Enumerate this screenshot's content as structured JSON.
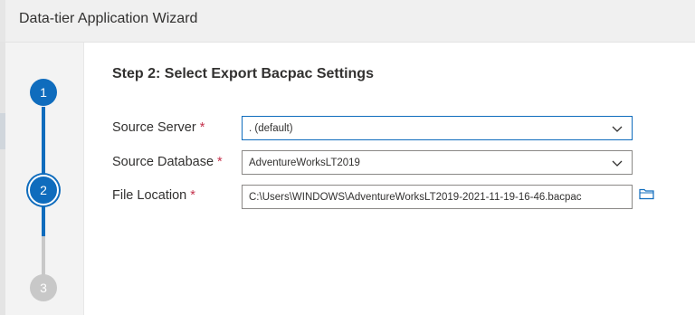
{
  "window": {
    "title": "Data-tier Application Wizard"
  },
  "steps": [
    {
      "number": "1",
      "state": "completed"
    },
    {
      "number": "2",
      "state": "current"
    },
    {
      "number": "3",
      "state": "pending"
    }
  ],
  "page": {
    "step_title": "Step 2: Select Export Bacpac Settings"
  },
  "form": {
    "source_server": {
      "label": "Source Server",
      "required_mark": "*",
      "value": ". (default)"
    },
    "source_database": {
      "label": "Source Database",
      "required_mark": "*",
      "value": "AdventureWorksLT2019"
    },
    "file_location": {
      "label": "File Location",
      "required_mark": "*",
      "value": "C:\\Users\\WINDOWS\\AdventureWorksLT2019-2021-11-19-16-46.bacpac"
    }
  },
  "colors": {
    "accent": "#0f6cbd",
    "required": "#c4314b",
    "inactive_step": "#c8c8c8"
  },
  "icons": {
    "dropdown": "chevron-down-icon",
    "browse": "folder-icon"
  }
}
